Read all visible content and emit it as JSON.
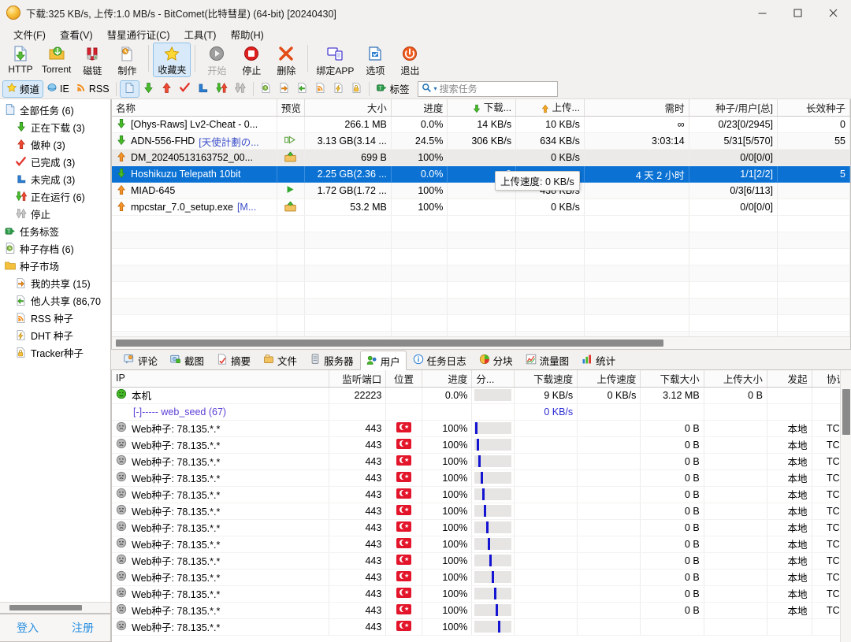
{
  "window": {
    "title": "下载:325 KB/s, 上传:1.0 MB/s - BitComet(比特彗星) (64-bit) [20240430]",
    "minimize": "—",
    "maximize": "□",
    "close": "✕"
  },
  "menubar": [
    {
      "label": "文件(F)"
    },
    {
      "label": "查看(V)"
    },
    {
      "label": "彗星通行证(C)"
    },
    {
      "label": "工具(T)"
    },
    {
      "label": "帮助(H)"
    }
  ],
  "toolbar": [
    {
      "label": "HTTP",
      "icon": "http-download-icon",
      "selected": false,
      "disabled": false
    },
    {
      "label": "Torrent",
      "icon": "torrent-icon",
      "selected": false,
      "disabled": false
    },
    {
      "label": "磁链",
      "icon": "magnet-icon",
      "selected": false,
      "disabled": false
    },
    {
      "label": "制作",
      "icon": "create-torrent-icon",
      "selected": false,
      "disabled": false
    },
    {
      "label": "收藏夹",
      "icon": "favorites-star-icon",
      "selected": true,
      "disabled": false
    },
    {
      "label": "开始",
      "icon": "start-icon",
      "selected": false,
      "disabled": true
    },
    {
      "label": "停止",
      "icon": "stop-icon",
      "selected": false,
      "disabled": false
    },
    {
      "label": "删除",
      "icon": "delete-x-icon",
      "selected": false,
      "disabled": false
    },
    {
      "label": "绑定APP",
      "icon": "bind-app-icon",
      "selected": false,
      "disabled": false
    },
    {
      "label": "选项",
      "icon": "options-icon",
      "selected": false,
      "disabled": false
    },
    {
      "label": "退出",
      "icon": "exit-icon",
      "selected": false,
      "disabled": false
    }
  ],
  "toolbar2": {
    "channel": {
      "label": "频道",
      "icon": "star-icon"
    },
    "ie": {
      "label": "IE",
      "icon": "ie-browser-icon"
    },
    "rss": {
      "label": "RSS",
      "icon": "rss-icon"
    },
    "filters": [
      {
        "icon": "all-tasks-icon",
        "selected": true
      },
      {
        "icon": "downloading-arrow-icon",
        "selected": false
      },
      {
        "icon": "seeding-arrow-icon",
        "selected": false
      },
      {
        "icon": "completed-check-icon",
        "selected": false
      },
      {
        "icon": "incomplete-icon",
        "selected": false
      },
      {
        "icon": "running-icon",
        "selected": false
      },
      {
        "icon": "stopped-icon",
        "selected": false
      }
    ],
    "seeds": [
      {
        "icon": "torrent-archive-icon"
      },
      {
        "icon": "my-share-icon"
      },
      {
        "icon": "others-share-icon"
      },
      {
        "icon": "rss-seed-icon"
      },
      {
        "icon": "dht-seed-icon"
      },
      {
        "icon": "tracker-seed-icon"
      }
    ],
    "tag": {
      "label": "标签",
      "icon": "tag-icon"
    },
    "search": {
      "placeholder": "搜索任务",
      "value": "",
      "icon": "search-icon"
    }
  },
  "sidebar": {
    "items": [
      {
        "label": "全部任务 (6)",
        "icon": "all-tasks-icon",
        "indent": false
      },
      {
        "label": "正在下载 (3)",
        "icon": "downloading-arrow-icon",
        "indent": true
      },
      {
        "label": "做种 (3)",
        "icon": "seeding-arrow-icon",
        "indent": true
      },
      {
        "label": "已完成 (3)",
        "icon": "completed-check-icon",
        "indent": true
      },
      {
        "label": "未完成 (3)",
        "icon": "incomplete-icon",
        "indent": true
      },
      {
        "label": "正在运行 (6)",
        "icon": "running-icon",
        "indent": true
      },
      {
        "label": "停止",
        "icon": "stopped-icon",
        "indent": true
      },
      {
        "label": "任务标签",
        "icon": "tag-icon",
        "indent": false
      },
      {
        "label": "种子存档 (6)",
        "icon": "torrent-archive-icon",
        "indent": false
      },
      {
        "label": "种子市场",
        "icon": "folder-icon",
        "indent": false
      },
      {
        "label": "我的共享 (15)",
        "icon": "my-share-icon",
        "indent": true
      },
      {
        "label": "他人共享 (86,70",
        "icon": "others-share-icon",
        "indent": true
      },
      {
        "label": "RSS 种子",
        "icon": "rss-seed-icon",
        "indent": true
      },
      {
        "label": "DHT 种子",
        "icon": "dht-seed-icon",
        "indent": true
      },
      {
        "label": "Tracker种子",
        "icon": "tracker-seed-icon",
        "indent": true
      }
    ],
    "login": {
      "signin": "登入",
      "register": "注册"
    }
  },
  "tasklist": {
    "columns": [
      {
        "label": "名称",
        "align": "l"
      },
      {
        "label": "预览",
        "align": "c"
      },
      {
        "label": "大小",
        "align": "r"
      },
      {
        "label": "进度",
        "align": "r"
      },
      {
        "label": "下载...",
        "align": "r",
        "icon": "download-arrow-icon"
      },
      {
        "label": "上传...",
        "align": "r",
        "icon": "upload-arrow-icon"
      },
      {
        "label": "需时",
        "align": "r"
      },
      {
        "label": "种子/用户[总]",
        "align": "r"
      },
      {
        "label": "长效种子",
        "align": "r"
      }
    ],
    "rows": [
      {
        "name": "[Ohys-Raws] Lv2-Cheat - 0...",
        "name_sub": "",
        "status_icon": "downloading-arrow-icon",
        "preview": "",
        "size": "266.1 MB",
        "progress": "0.0%",
        "down": "14 KB/s",
        "up": "10 KB/s",
        "eta": "∞",
        "peers": "0/23[0/2945]",
        "longseeds": "0",
        "selected": false,
        "shade": "normal"
      },
      {
        "name": "ADN-556-FHD ",
        "name_sub": "[天使計劃の...",
        "status_icon": "downloading-arrow-icon",
        "preview": "preview-play-icon",
        "size": "3.13 GB(3.14 ...",
        "progress": "24.5%",
        "down": "306 KB/s",
        "up": "634 KB/s",
        "eta": "3:03:14",
        "peers": "5/31[5/570]",
        "longseeds": "55",
        "selected": false,
        "shade": "alt"
      },
      {
        "name": "DM_20240513163752_00...",
        "name_sub": "",
        "status_icon": "seeding-arrow-icon",
        "preview": "seed-box-icon",
        "size": "699 B",
        "progress": "100%",
        "down": "",
        "up": "0 KB/s",
        "eta": "",
        "peers": "0/0[0/0]",
        "longseeds": "",
        "selected": false,
        "shade": "grey"
      },
      {
        "name": "Hoshikuzu Telepath 10bit",
        "name_sub": "",
        "status_icon": "downloading-arrow-icon",
        "preview": "",
        "size": "2.25 GB(2.36 ...",
        "progress": "0.0%",
        "down": "9",
        "up": "s",
        "eta": "4 天 2 小时",
        "peers": "1/1[2/2]",
        "longseeds": "5",
        "selected": true,
        "shade": "normal"
      },
      {
        "name": "MIAD-645",
        "name_sub": "",
        "status_icon": "seeding-arrow-icon",
        "preview": "preview-play-green-icon",
        "size": "1.72 GB(1.72 ...",
        "progress": "100%",
        "down": "",
        "up": "438 KB/s",
        "eta": "",
        "peers": "0/3[6/113]",
        "longseeds": "",
        "selected": false,
        "shade": "alt"
      },
      {
        "name": "mpcstar_7.0_setup.exe ",
        "name_sub": "[M...",
        "status_icon": "seeding-arrow-icon",
        "preview": "seed-box-icon",
        "size": "53.2 MB",
        "progress": "100%",
        "down": "",
        "up": "0 KB/s",
        "eta": "",
        "peers": "0/0[0/0]",
        "longseeds": "",
        "selected": false,
        "shade": "normal"
      }
    ],
    "tooltip": "上传速度: 0 KB/s"
  },
  "detail_tabs": [
    {
      "label": "评论",
      "icon": "comment-icon",
      "selected": false
    },
    {
      "label": "截图",
      "icon": "screenshot-icon",
      "selected": false
    },
    {
      "label": "摘要",
      "icon": "summary-icon",
      "selected": false
    },
    {
      "label": "文件",
      "icon": "file-icon",
      "selected": false
    },
    {
      "label": "服务器",
      "icon": "server-icon",
      "selected": false
    },
    {
      "label": "用户",
      "icon": "peers-icon",
      "selected": true
    },
    {
      "label": "任务日志",
      "icon": "log-info-icon",
      "selected": false
    },
    {
      "label": "分块",
      "icon": "pieces-icon",
      "selected": false
    },
    {
      "label": "流量图",
      "icon": "traffic-chart-icon",
      "selected": false
    },
    {
      "label": "统计",
      "icon": "statistics-icon",
      "selected": false
    }
  ],
  "peertable": {
    "columns": [
      {
        "label": "IP",
        "align": "l"
      },
      {
        "label": "监听端口",
        "align": "r"
      },
      {
        "label": "位置",
        "align": "c"
      },
      {
        "label": "进度",
        "align": "r"
      },
      {
        "label": "分...",
        "align": "l"
      },
      {
        "label": "下载速度",
        "align": "r"
      },
      {
        "label": "上传速度",
        "align": "r"
      },
      {
        "label": "下载大小",
        "align": "r"
      },
      {
        "label": "上传大小",
        "align": "r"
      },
      {
        "label": "发起",
        "align": "r"
      },
      {
        "label": "协议",
        "align": "r"
      }
    ],
    "rows": [
      {
        "ip": "本机",
        "icon": "local-peer-icon",
        "port": "22223",
        "flag": false,
        "progress": "0.0%",
        "block": -1,
        "down": "9 KB/s",
        "up": "0 KB/s",
        "dsize": "3.12 MB",
        "usize": "0 B",
        "origin": "",
        "protocol": "",
        "style": "local"
      },
      {
        "ip": "[-]----- web_seed (67)",
        "icon": "",
        "port": "",
        "flag": false,
        "progress": "",
        "block": -1,
        "down": "0 KB/s",
        "up": "",
        "dsize": "",
        "usize": "",
        "origin": "",
        "protocol": "",
        "style": "webseed-group"
      },
      {
        "ip": "Web种子: 78.135.*.*",
        "icon": "peer-icon",
        "port": "443",
        "flag": true,
        "progress": "100%",
        "block": 2,
        "down": "",
        "up": "",
        "dsize": "0 B",
        "usize": "",
        "origin": "本地",
        "protocol": "TCP",
        "style": "peer"
      },
      {
        "ip": "Web种子: 78.135.*.*",
        "icon": "peer-icon",
        "port": "443",
        "flag": true,
        "progress": "100%",
        "block": 6,
        "down": "",
        "up": "",
        "dsize": "0 B",
        "usize": "",
        "origin": "本地",
        "protocol": "TCP",
        "style": "peer"
      },
      {
        "ip": "Web种子: 78.135.*.*",
        "icon": "peer-icon",
        "port": "443",
        "flag": true,
        "progress": "100%",
        "block": 11,
        "down": "",
        "up": "",
        "dsize": "0 B",
        "usize": "",
        "origin": "本地",
        "protocol": "TCP",
        "style": "peer"
      },
      {
        "ip": "Web种子: 78.135.*.*",
        "icon": "peer-icon",
        "port": "443",
        "flag": true,
        "progress": "100%",
        "block": 16,
        "down": "",
        "up": "",
        "dsize": "0 B",
        "usize": "",
        "origin": "本地",
        "protocol": "TCP",
        "style": "peer"
      },
      {
        "ip": "Web种子: 78.135.*.*",
        "icon": "peer-icon",
        "port": "443",
        "flag": true,
        "progress": "100%",
        "block": 21,
        "down": "",
        "up": "",
        "dsize": "0 B",
        "usize": "",
        "origin": "本地",
        "protocol": "TCP",
        "style": "peer"
      },
      {
        "ip": "Web种子: 78.135.*.*",
        "icon": "peer-icon",
        "port": "443",
        "flag": true,
        "progress": "100%",
        "block": 26,
        "down": "",
        "up": "",
        "dsize": "0 B",
        "usize": "",
        "origin": "本地",
        "protocol": "TCP",
        "style": "peer"
      },
      {
        "ip": "Web种子: 78.135.*.*",
        "icon": "peer-icon",
        "port": "443",
        "flag": true,
        "progress": "100%",
        "block": 31,
        "down": "",
        "up": "",
        "dsize": "0 B",
        "usize": "",
        "origin": "本地",
        "protocol": "TCP",
        "style": "peer"
      },
      {
        "ip": "Web种子: 78.135.*.*",
        "icon": "peer-icon",
        "port": "443",
        "flag": true,
        "progress": "100%",
        "block": 36,
        "down": "",
        "up": "",
        "dsize": "0 B",
        "usize": "",
        "origin": "本地",
        "protocol": "TCP",
        "style": "peer"
      },
      {
        "ip": "Web种子: 78.135.*.*",
        "icon": "peer-icon",
        "port": "443",
        "flag": true,
        "progress": "100%",
        "block": 41,
        "down": "",
        "up": "",
        "dsize": "0 B",
        "usize": "",
        "origin": "本地",
        "protocol": "TCP",
        "style": "peer"
      },
      {
        "ip": "Web种子: 78.135.*.*",
        "icon": "peer-icon",
        "port": "443",
        "flag": true,
        "progress": "100%",
        "block": 46,
        "down": "",
        "up": "",
        "dsize": "0 B",
        "usize": "",
        "origin": "本地",
        "protocol": "TCP",
        "style": "peer"
      },
      {
        "ip": "Web种子: 78.135.*.*",
        "icon": "peer-icon",
        "port": "443",
        "flag": true,
        "progress": "100%",
        "block": 52,
        "down": "",
        "up": "",
        "dsize": "0 B",
        "usize": "",
        "origin": "本地",
        "protocol": "TCP",
        "style": "peer"
      },
      {
        "ip": "Web种子: 78.135.*.*",
        "icon": "peer-icon",
        "port": "443",
        "flag": true,
        "progress": "100%",
        "block": 58,
        "down": "",
        "up": "",
        "dsize": "0 B",
        "usize": "",
        "origin": "本地",
        "protocol": "TCP",
        "style": "peer"
      },
      {
        "ip": "Web种子: 78.135.*.*",
        "icon": "peer-icon",
        "port": "443",
        "flag": true,
        "progress": "100%",
        "block": 64,
        "down": "",
        "up": "",
        "dsize": "",
        "usize": "",
        "origin": "",
        "protocol": "",
        "style": "peer"
      }
    ]
  },
  "colors": {
    "selection": "#0b72d4",
    "link": "#2a8fe0",
    "accent_blue": "#1414d2",
    "webseed_purple": "#5a3fd6",
    "flag_red": "#e3152a"
  }
}
